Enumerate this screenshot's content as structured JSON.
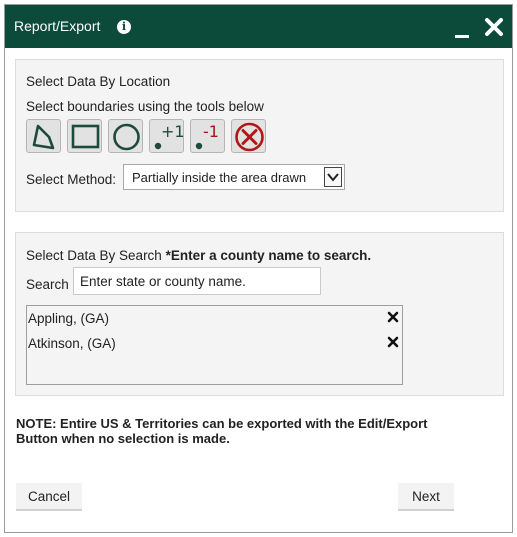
{
  "window": {
    "title": "Report/Export",
    "info_icon": "info-icon",
    "minimize_icon": "minimize-icon",
    "close_icon": "close-icon"
  },
  "location_section": {
    "heading": "Select Data By Location",
    "subheading": "Select boundaries using the tools below",
    "tools": [
      {
        "name": "polygon-tool",
        "icon": "polygon-icon"
      },
      {
        "name": "rectangle-tool",
        "icon": "rectangle-icon"
      },
      {
        "name": "circle-tool",
        "icon": "circle-icon"
      },
      {
        "name": "add-point-tool",
        "icon": "add-point-icon",
        "label": "+1"
      },
      {
        "name": "remove-point-tool",
        "icon": "remove-point-icon",
        "label": "-1"
      },
      {
        "name": "clear-tool",
        "icon": "clear-icon"
      }
    ],
    "method_label": "Select Method:",
    "method_value": "Partially inside the area drawn"
  },
  "search_section": {
    "heading": "Select Data By Search",
    "hint": "*Enter a county name to search.",
    "search_label": "Search",
    "search_placeholder": "Enter state or county name.",
    "results": [
      "Appling, (GA)",
      "Atkinson, (GA)"
    ]
  },
  "note": "NOTE: Entire US & Territories can be exported with the Edit/Export Button when no selection is made.",
  "buttons": {
    "cancel": "Cancel",
    "next": "Next"
  },
  "colors": {
    "titlebar": "#0c4a3a",
    "tool_icon": "#1e4a3e",
    "remove_point": "#a01818",
    "clear": "#b01818"
  }
}
